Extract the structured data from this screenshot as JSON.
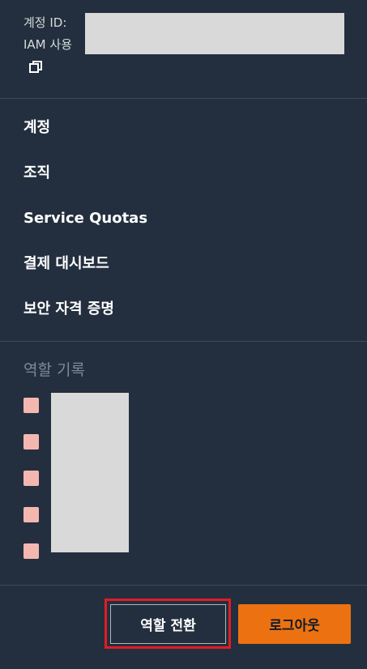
{
  "account": {
    "id_label": "계정 ID:",
    "iam_label": "IAM 사용",
    "copy_icon": "copy-icon"
  },
  "menu": {
    "items": [
      {
        "label": "계정"
      },
      {
        "label": "조직"
      },
      {
        "label": "Service Quotas"
      },
      {
        "label": "결제 대시보드"
      },
      {
        "label": "보안 자격 증명"
      }
    ]
  },
  "role_history": {
    "title": "역할 기록",
    "swatch_color": "#f4b7b0",
    "items": [
      {},
      {},
      {},
      {},
      {}
    ]
  },
  "footer": {
    "switch_role_label": "역할 전환",
    "logout_label": "로그아웃",
    "logout_color": "#ec7211",
    "highlight_color": "#e31b23"
  }
}
